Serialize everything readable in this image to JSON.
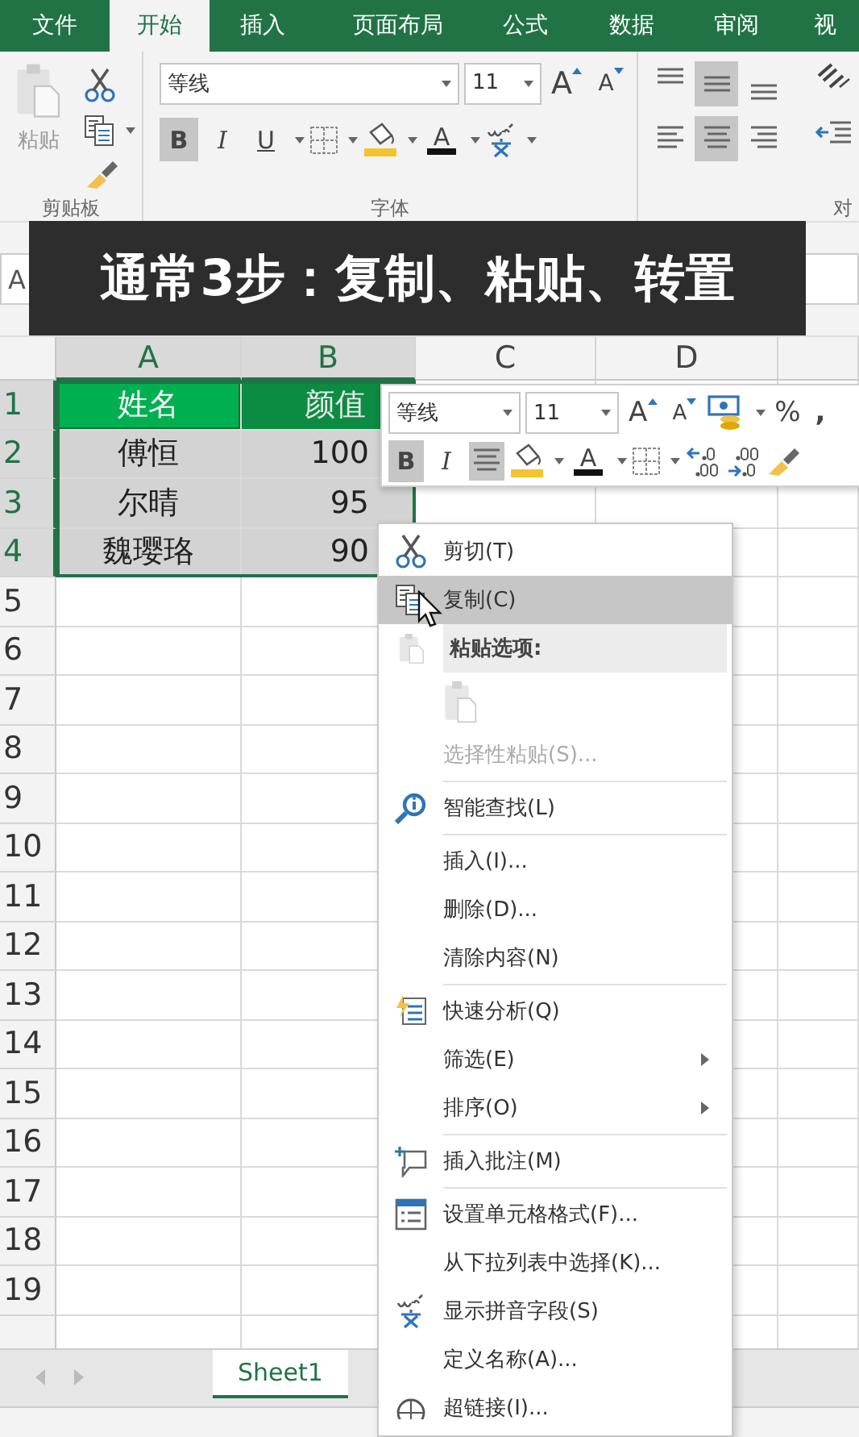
{
  "ribbon_tabs": [
    {
      "label": "文件",
      "selected": false
    },
    {
      "label": "开始",
      "selected": true
    },
    {
      "label": "插入",
      "selected": false
    },
    {
      "label": "页面布局",
      "selected": false
    },
    {
      "label": "公式",
      "selected": false
    },
    {
      "label": "数据",
      "selected": false
    },
    {
      "label": "审阅",
      "selected": false
    },
    {
      "label": "视",
      "selected": false
    }
  ],
  "clipboard_group": {
    "paste_label": "粘贴",
    "label": "剪贴板"
  },
  "font_group": {
    "font": "等线",
    "size": "11",
    "grow_label": "A",
    "shrink_label": "A",
    "format_buttons": [
      {
        "label": "B",
        "selected": true
      },
      {
        "label": "I",
        "selected": false
      },
      {
        "label": "U",
        "selected": false
      }
    ],
    "font_color_label": "A",
    "label": "字体"
  },
  "alignment_group": {
    "buttons": [
      {
        "selected": false
      },
      {
        "selected": true
      },
      {
        "selected": false
      },
      {
        "selected": false
      },
      {
        "selected": true
      },
      {
        "selected": false
      }
    ],
    "label": "对"
  },
  "name_box": "A",
  "caption": "通常3步：复制、粘贴、转置",
  "columns": [
    {
      "label": "A",
      "selected": true
    },
    {
      "label": "B",
      "selected": true
    },
    {
      "label": "C",
      "selected": false
    },
    {
      "label": "D",
      "selected": false
    }
  ],
  "rows": [
    {
      "number": "1",
      "selected": true,
      "cells": [
        {
          "text": "姓名",
          "kind": "header",
          "active": true
        },
        {
          "text": "颜值",
          "kind": "header",
          "active": false
        }
      ]
    },
    {
      "number": "2",
      "selected": true,
      "cells": [
        {
          "text": "傅恒",
          "kind": "data",
          "active": false
        },
        {
          "text": "100",
          "kind": "data",
          "active": false
        }
      ]
    },
    {
      "number": "3",
      "selected": true,
      "cells": [
        {
          "text": "尔晴",
          "kind": "data",
          "active": false
        },
        {
          "text": "95",
          "kind": "data",
          "active": false
        }
      ]
    },
    {
      "number": "4",
      "selected": true,
      "cells": [
        {
          "text": "魏璎珞",
          "kind": "data",
          "active": false
        },
        {
          "text": "90",
          "kind": "data",
          "active": false
        }
      ]
    },
    {
      "number": "5",
      "selected": false
    },
    {
      "number": "6",
      "selected": false
    },
    {
      "number": "7",
      "selected": false
    },
    {
      "number": "8",
      "selected": false
    },
    {
      "number": "9",
      "selected": false
    },
    {
      "number": "10",
      "selected": false
    },
    {
      "number": "11",
      "selected": false
    },
    {
      "number": "12",
      "selected": false
    },
    {
      "number": "13",
      "selected": false
    },
    {
      "number": "14",
      "selected": false
    },
    {
      "number": "15",
      "selected": false
    },
    {
      "number": "16",
      "selected": false
    },
    {
      "number": "17",
      "selected": false
    },
    {
      "number": "18",
      "selected": false
    },
    {
      "number": "19",
      "selected": false
    }
  ],
  "mini_toolbar": {
    "font": "等线",
    "size": "11",
    "grow_label": "A",
    "shrink_label": "A",
    "percent": "%",
    "comma": ",",
    "format_buttons": [
      {
        "label": "B",
        "selected": true
      },
      {
        "label": "I",
        "selected": false
      }
    ],
    "center_selected": true,
    "font_color_label": "A"
  },
  "context_menu": {
    "items": [
      {
        "kind": "item",
        "text": "剪切(T)",
        "selected": false,
        "disabled": false
      },
      {
        "kind": "item",
        "text": "复制(C)",
        "selected": true,
        "disabled": false
      },
      {
        "kind": "heading",
        "text": "粘贴选项:"
      },
      {
        "kind": "paste-option"
      },
      {
        "kind": "item",
        "text": "选择性粘贴(S)...",
        "selected": false,
        "disabled": true
      },
      {
        "kind": "separator"
      },
      {
        "kind": "item",
        "text": "智能查找(L)",
        "selected": false,
        "disabled": false
      },
      {
        "kind": "separator"
      },
      {
        "kind": "item",
        "text": "插入(I)...",
        "selected": false,
        "disabled": false
      },
      {
        "kind": "item",
        "text": "删除(D)...",
        "selected": false,
        "disabled": false
      },
      {
        "kind": "item",
        "text": "清除内容(N)",
        "selected": false,
        "disabled": false
      },
      {
        "kind": "separator"
      },
      {
        "kind": "item",
        "text": "快速分析(Q)",
        "selected": false,
        "disabled": false
      },
      {
        "kind": "item",
        "text": "筛选(E)",
        "selected": false,
        "disabled": false,
        "submenu": true
      },
      {
        "kind": "item",
        "text": "排序(O)",
        "selected": false,
        "disabled": false,
        "submenu": true
      },
      {
        "kind": "separator"
      },
      {
        "kind": "item",
        "text": "插入批注(M)",
        "selected": false,
        "disabled": false
      },
      {
        "kind": "separator"
      },
      {
        "kind": "item",
        "text": "设置单元格格式(F)...",
        "selected": false,
        "disabled": false
      },
      {
        "kind": "item",
        "text": "从下拉列表中选择(K)...",
        "selected": false,
        "disabled": false
      },
      {
        "kind": "item",
        "text": "显示拼音字段(S)",
        "selected": false,
        "disabled": false
      },
      {
        "kind": "item",
        "text": "定义名称(A)...",
        "selected": false,
        "disabled": false
      },
      {
        "kind": "item",
        "text": "超链接(I)...",
        "selected": false,
        "disabled": false
      }
    ]
  },
  "sheet_tabs": [
    {
      "label": "Sheet1",
      "selected": true
    }
  ]
}
